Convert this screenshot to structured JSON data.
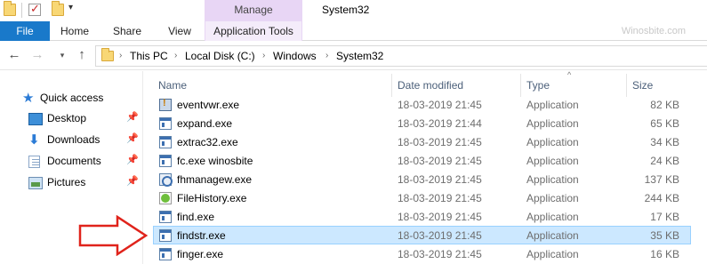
{
  "window": {
    "title": "System32",
    "contextual_tab_group": "Manage",
    "watermark": "Winosbite.com"
  },
  "ribbon": {
    "tabs": [
      {
        "label": "File"
      },
      {
        "label": "Home"
      },
      {
        "label": "Share"
      },
      {
        "label": "View"
      },
      {
        "label": "Application Tools"
      }
    ]
  },
  "address_bar": {
    "crumbs": [
      "This PC",
      "Local Disk (C:)",
      "Windows",
      "System32"
    ]
  },
  "nav_pane": {
    "items": [
      {
        "label": "Quick access",
        "icon": "star-icon",
        "pinned": false
      },
      {
        "label": "Desktop",
        "icon": "desktop-icon",
        "pinned": true
      },
      {
        "label": "Downloads",
        "icon": "download-icon",
        "pinned": true
      },
      {
        "label": "Documents",
        "icon": "documents-icon",
        "pinned": true
      },
      {
        "label": "Pictures",
        "icon": "pictures-icon",
        "pinned": true
      }
    ]
  },
  "file_list": {
    "columns": {
      "name": "Name",
      "date": "Date modified",
      "type": "Type",
      "size": "Size"
    },
    "rows": [
      {
        "name": "eventvwr.exe",
        "date": "18-03-2019 21:45",
        "type": "Application",
        "size": "82 KB",
        "icon": "event-viewer-icon"
      },
      {
        "name": "expand.exe",
        "date": "18-03-2019 21:44",
        "type": "Application",
        "size": "65 KB",
        "icon": "application-icon"
      },
      {
        "name": "extrac32.exe",
        "date": "18-03-2019 21:45",
        "type": "Application",
        "size": "34 KB",
        "icon": "application-icon"
      },
      {
        "name": "fc.exe winosbite",
        "date": "18-03-2019 21:45",
        "type": "Application",
        "size": "24 KB",
        "icon": "application-icon"
      },
      {
        "name": "fhmanagew.exe",
        "date": "18-03-2019 21:45",
        "type": "Application",
        "size": "137 KB",
        "icon": "file-history-manager-icon"
      },
      {
        "name": "FileHistory.exe",
        "date": "18-03-2019 21:45",
        "type": "Application",
        "size": "244 KB",
        "icon": "file-history-icon"
      },
      {
        "name": "find.exe",
        "date": "18-03-2019 21:45",
        "type": "Application",
        "size": "17 KB",
        "icon": "application-icon"
      },
      {
        "name": "findstr.exe",
        "date": "18-03-2019 21:45",
        "type": "Application",
        "size": "35 KB",
        "icon": "application-icon",
        "selected": true
      },
      {
        "name": "finger.exe",
        "date": "18-03-2019 21:45",
        "type": "Application",
        "size": "16 KB",
        "icon": "application-icon"
      }
    ]
  },
  "colors": {
    "file_tab": "#1979ca",
    "manage_tab": "#e8d6f5",
    "selection": "#cce8ff",
    "annotation_arrow": "#e0231b"
  }
}
